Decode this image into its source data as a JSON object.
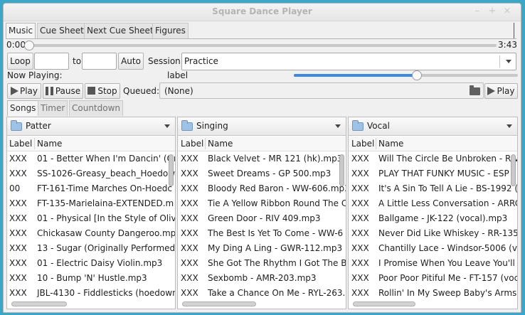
{
  "window": {
    "title": "Square Dance Player",
    "min_glyph": "–",
    "max_glyph": "+",
    "close_glyph": "×"
  },
  "main_tabs": [
    "Music",
    "Cue Sheet",
    "Next Cue Sheet",
    "Figures"
  ],
  "position": {
    "start": "0:00",
    "end": "3:43",
    "progress": 0.0
  },
  "loop": {
    "loop_label": "Loop",
    "from_value": "",
    "to_label": "to",
    "to_value": "",
    "auto_label": "Auto"
  },
  "session": {
    "label": "Session",
    "value": "Practice"
  },
  "now_playing": {
    "label": "Now Playing:",
    "value": "label",
    "volume": 0.55
  },
  "transport": {
    "play": "Play",
    "pause": "Pause",
    "stop": "Stop",
    "queued_label": "Queued:",
    "queued_value": "(None)",
    "play2": "Play"
  },
  "lower_tabs": [
    "Songs",
    "Timer",
    "Countdown"
  ],
  "columns": {
    "label": "Label",
    "name": "Name"
  },
  "icons": {
    "folder": "folder-icon",
    "play": "play-icon",
    "pause": "pause-icon",
    "stop": "stop-icon",
    "dropdown": "chevron-down-icon"
  },
  "panels": [
    {
      "category": "Patter",
      "rows": [
        {
          "label": "XXX",
          "name": "01 - Better When I'm Dancin' (Or"
        },
        {
          "label": "XXX",
          "name": "SS-1026-Greasy_beach_Hoedow"
        },
        {
          "label": "00",
          "name": "FT-161-Time Marches On-Hoedc"
        },
        {
          "label": "XXX",
          "name": "FT-135-Marielaina-EXTENDED.m"
        },
        {
          "label": "XXX",
          "name": "01 - Physical [In the Style of Olivi"
        },
        {
          "label": "XXX",
          "name": "Chickasaw County Dangeroo.mp"
        },
        {
          "label": "XXX",
          "name": "13 - Sugar (Originally Performed"
        },
        {
          "label": "XXX",
          "name": "01 - Electric Daisy Violin.mp3"
        },
        {
          "label": "XXX",
          "name": "10 - Bump 'N' Hustle.mp3"
        },
        {
          "label": "XXX",
          "name": "JBL-4130 - Fiddlesticks (hoedown"
        }
      ]
    },
    {
      "category": "Singing",
      "rows": [
        {
          "label": "XXX",
          "name": "Black Velvet - MR 121 (hk).mp3"
        },
        {
          "label": "XXX",
          "name": "Sweet Dreams - GP 500.mp3"
        },
        {
          "label": "XXX",
          "name": "Bloody Red Baron - WW-606.mp3"
        },
        {
          "label": "XXX",
          "name": "Tie A Yellow Ribbon Round The C"
        },
        {
          "label": "XXX",
          "name": "Green Door - RIV 409.mp3"
        },
        {
          "label": "XXX",
          "name": "The Best Is Yet To Come - WW-6"
        },
        {
          "label": "XXX",
          "name": "My Ding A Ling - GWR-112.mp3"
        },
        {
          "label": "XXX",
          "name": "She Got The Rhythm I Got The Bl"
        },
        {
          "label": "XXX",
          "name": "Sexbomb - AMR-203.mp3"
        },
        {
          "label": "XXX",
          "name": "Take a Chance On Me - RYL-263."
        }
      ]
    },
    {
      "category": "Vocal",
      "rows": [
        {
          "label": "XXX",
          "name": "Will The Circle Be Unbroken - RIV"
        },
        {
          "label": "XXX",
          "name": "PLAY THAT FUNKY MUSIC - ESP"
        },
        {
          "label": "XXX",
          "name": "It's A Sin To Tell A Lie - BS-1992 ("
        },
        {
          "label": "XXX",
          "name": "A Little Less Conversation - ARRC"
        },
        {
          "label": "XXX",
          "name": "Ballgame - JK-122 (vocal).mp3"
        },
        {
          "label": "XXX",
          "name": "Never Did Like Whiskey - RR-135"
        },
        {
          "label": "XXX",
          "name": "Chantilly Lace - Windsor-5006 (vo"
        },
        {
          "label": "XXX",
          "name": "I Promise When You Leave You'll"
        },
        {
          "label": "XXX",
          "name": "Poor Poor Pitiful Me - FT-157 (voc"
        },
        {
          "label": "XXX",
          "name": "Rollin' In My Sweep Baby's Arms"
        }
      ]
    }
  ]
}
